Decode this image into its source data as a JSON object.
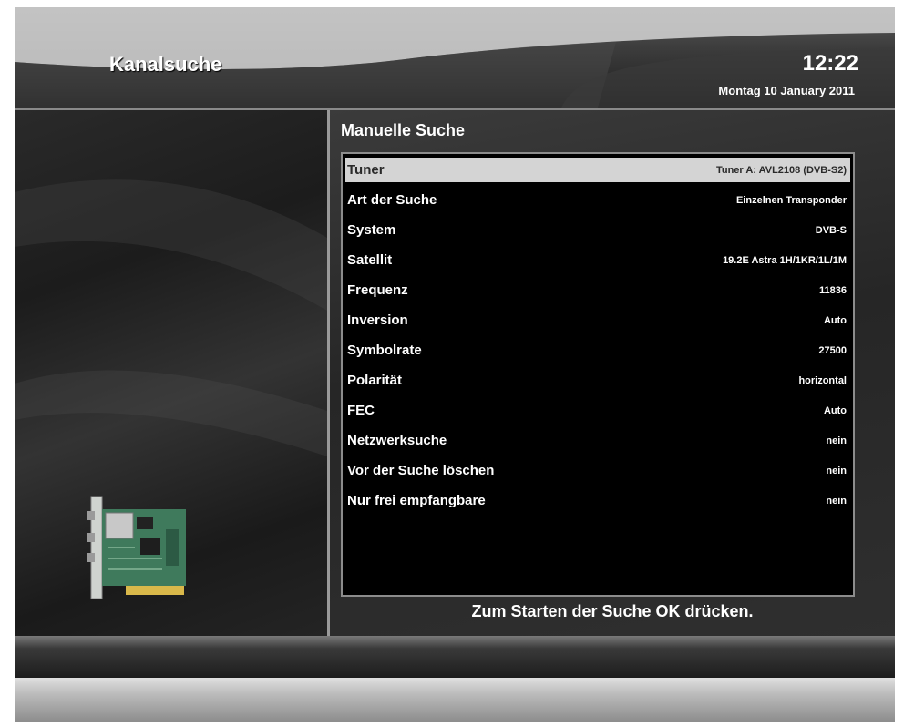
{
  "header": {
    "title": "Kanalsuche",
    "time": "12:22",
    "date": "Montag 10 January 2011"
  },
  "panel": {
    "title": "Manuelle Suche",
    "hint": "Zum Starten der Suche OK drücken."
  },
  "menu": {
    "selected_index": 0,
    "rows": [
      {
        "label": "Tuner",
        "value": "Tuner A: AVL2108 (DVB-S2)"
      },
      {
        "label": "Art der Suche",
        "value": "Einzelnen Transponder"
      },
      {
        "label": "System",
        "value": "DVB-S"
      },
      {
        "label": "Satellit",
        "value": "19.2E Astra 1H/1KR/1L/1M"
      },
      {
        "label": "Frequenz",
        "value": "11836"
      },
      {
        "label": "Inversion",
        "value": "Auto"
      },
      {
        "label": "Symbolrate",
        "value": "27500"
      },
      {
        "label": "Polarität",
        "value": "horizontal"
      },
      {
        "label": "FEC",
        "value": "Auto"
      },
      {
        "label": "Netzwerksuche",
        "value": "nein"
      },
      {
        "label": "Vor der Suche löschen",
        "value": "nein"
      },
      {
        "label": "Nur frei empfangbare",
        "value": "nein"
      }
    ]
  },
  "icons": {
    "illustration": "tuner-card-icon"
  },
  "colors": {
    "selection": "#d4d4d4",
    "background": "#000000",
    "text": "#ffffff"
  }
}
